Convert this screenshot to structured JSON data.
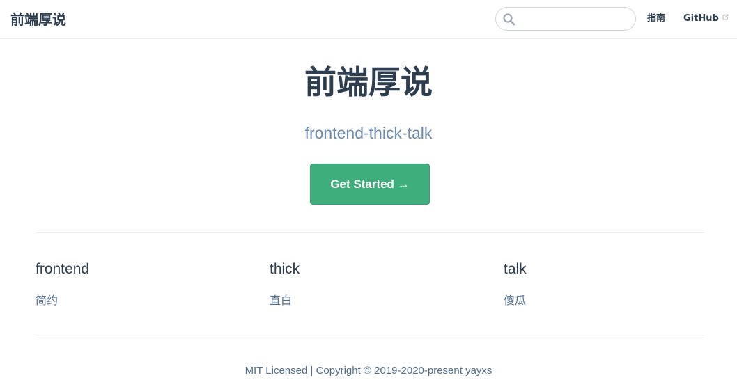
{
  "navbar": {
    "site_name": "前端厚说",
    "search": {
      "value": "",
      "placeholder": ""
    },
    "links": [
      {
        "label": "指南"
      },
      {
        "label": "GitHub"
      }
    ]
  },
  "hero": {
    "title": "前端厚说",
    "description": "frontend-thick-talk",
    "action_label": "Get Started →"
  },
  "features": [
    {
      "title": "frontend",
      "details": "简约"
    },
    {
      "title": "thick",
      "details": "直白"
    },
    {
      "title": "talk",
      "details": "傻瓜"
    }
  ],
  "footer": {
    "text": "MIT Licensed | Copyright © 2019-2020-present yayxs"
  },
  "colors": {
    "accent": "#3eaf7c",
    "text": "#2c3e50",
    "description": "#6a8bad",
    "border": "#eaecef"
  }
}
